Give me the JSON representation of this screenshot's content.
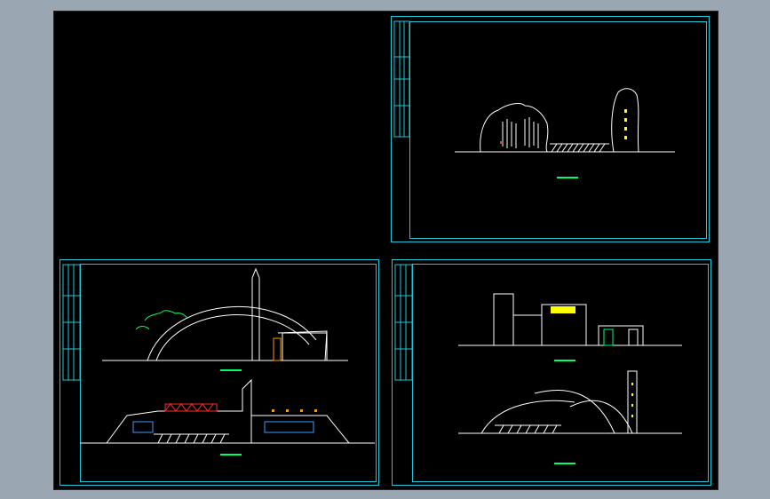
{
  "window": {
    "background_color": "#9aa6b2",
    "canvas_color": "#000000"
  },
  "colors": {
    "frame": "#1ec8d8",
    "line": "#ffffff",
    "accent_green": "#00ff66",
    "accent_yellow": "#ffff00",
    "accent_red": "#ff2a2a",
    "accent_orange": "#ff9900"
  },
  "sheets": [
    {
      "id": "sheet-top-right",
      "subject": "rock-gate-elevation"
    },
    {
      "id": "sheet-bottom-left",
      "subject": "arch-gate-elevations"
    },
    {
      "id": "sheet-bottom-right",
      "subject": "building-gate-elevations"
    }
  ]
}
